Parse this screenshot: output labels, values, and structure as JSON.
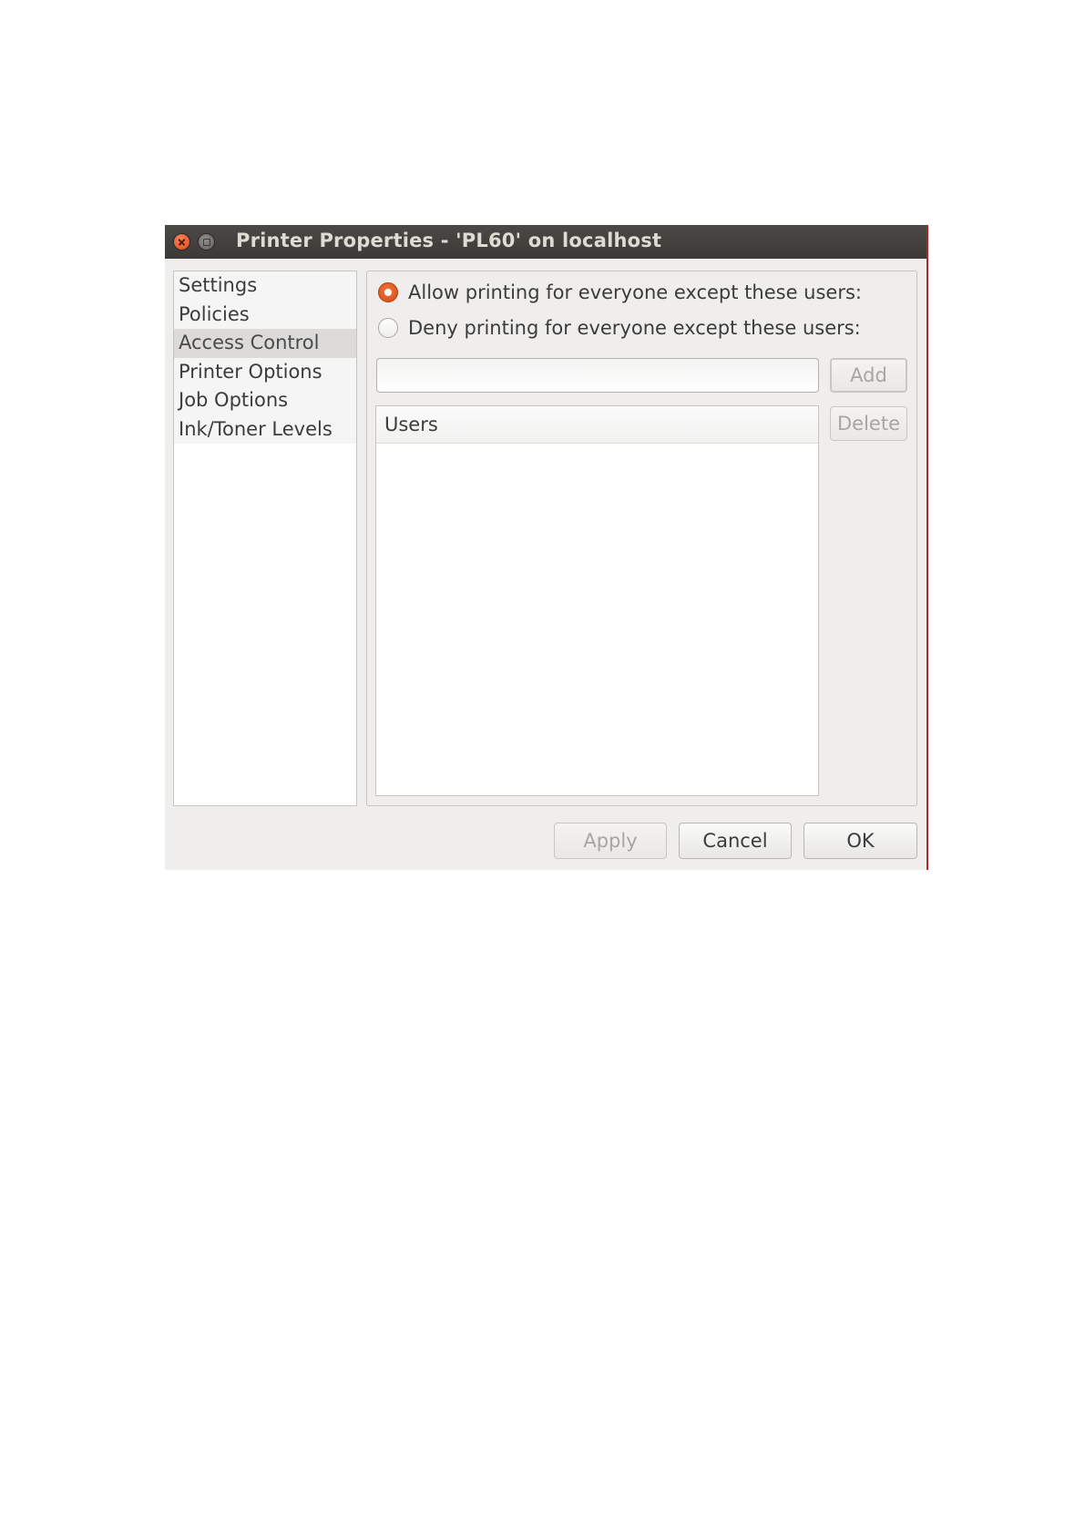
{
  "window": {
    "title": "Printer Properties - 'PL60' on localhost"
  },
  "sidebar": {
    "items": [
      {
        "label": "Settings"
      },
      {
        "label": "Policies"
      },
      {
        "label": "Access Control",
        "selected": true
      },
      {
        "label": "Printer Options"
      },
      {
        "label": "Job Options"
      },
      {
        "label": "Ink/Toner Levels"
      }
    ]
  },
  "access_control": {
    "allow_option": {
      "label": "Allow printing for everyone except these users:",
      "checked": true
    },
    "deny_option": {
      "label": "Deny printing for everyone except these users:",
      "checked": false
    },
    "user_input": {
      "value": "",
      "placeholder": ""
    },
    "add_label": "Add",
    "delete_label": "Delete",
    "users_column_header": "Users",
    "users": []
  },
  "footer": {
    "apply_label": "Apply",
    "cancel_label": "Cancel",
    "ok_label": "OK"
  },
  "colors": {
    "titlebar": "#3b3a37",
    "accent_radio": "#df4a16",
    "close_button": "#df4a16",
    "window_bg": "#efeeed"
  },
  "icons": {
    "close": "close-icon",
    "minimize": "minimize-icon"
  }
}
